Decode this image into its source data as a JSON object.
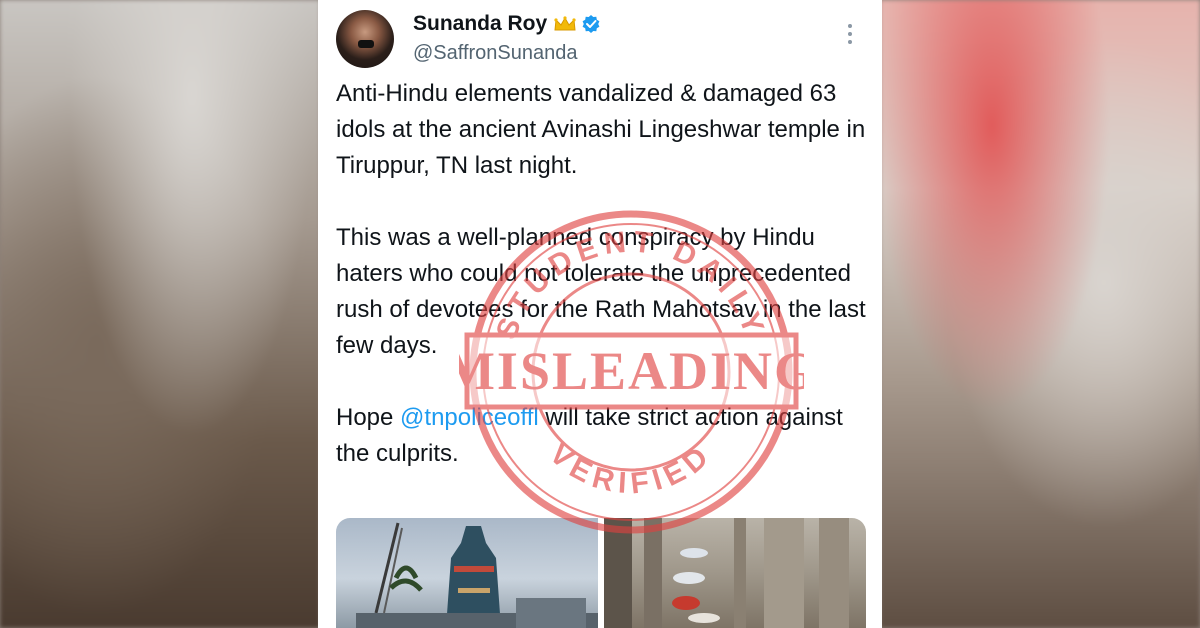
{
  "user": {
    "display_name": "Sunanda Roy",
    "handle": "@SaffronSunanda",
    "badges": [
      "crown-icon",
      "verified-icon"
    ]
  },
  "tweet": {
    "paragraph_1": "Anti-Hindu elements vandalized & damaged 63 idols at the ancient Avinashi Lingeshwar temple in Tiruppur, TN last night.",
    "paragraph_2": "This was a well-planned conspiracy by Hindu haters who could not tolerate the unprecedented rush of devotees for the Rath Mahotsav in the last few days.",
    "paragraph_3_prefix": "Hope ",
    "mention": "@tnpoliceoffl",
    "paragraph_3_suffix": " will take strict action against the culprits."
  },
  "stamp": {
    "top_text": "STUDENT DAILY",
    "label": "MISLEADING",
    "bottom_text": "VERIFIED",
    "color": "#e0413f"
  },
  "colors": {
    "link": "#1d9bf0",
    "verified": "#1d9bf0",
    "text": "#0f1419",
    "secondary": "#536471"
  }
}
